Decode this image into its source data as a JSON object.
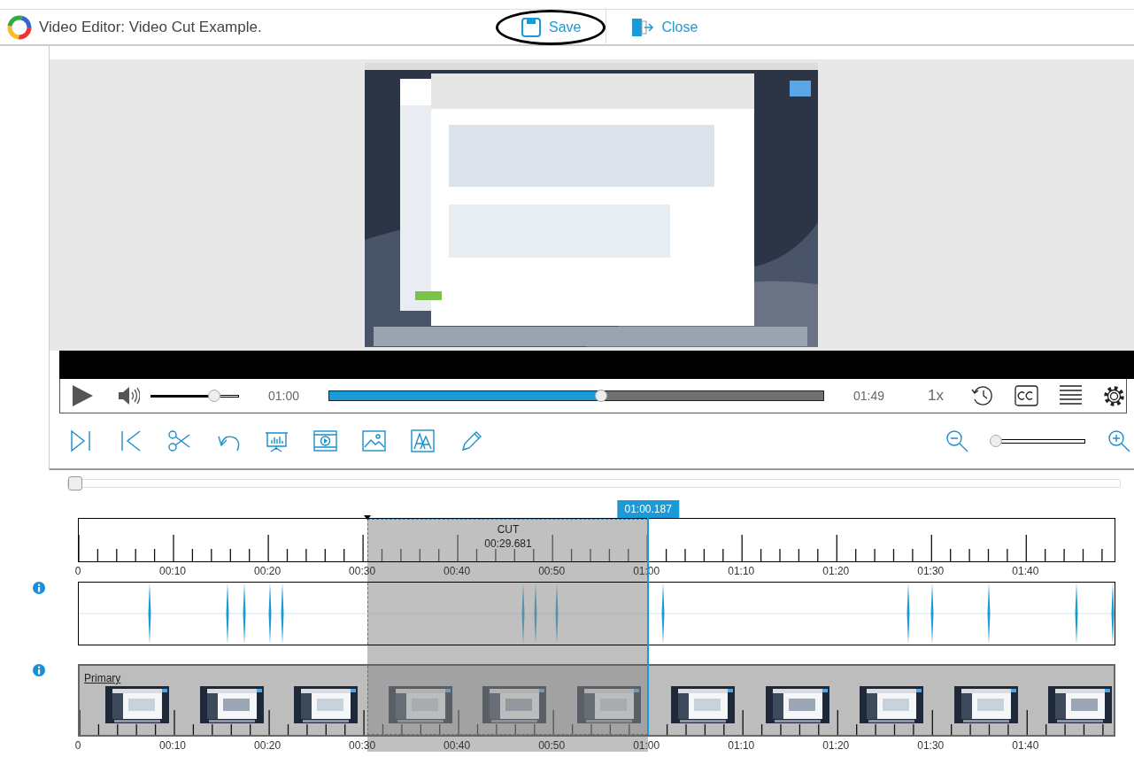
{
  "app": {
    "title": "Video Editor: Video Cut Example."
  },
  "header_buttons": [
    {
      "label": "Save",
      "kind": "save",
      "highlighted": true
    },
    {
      "label": "Close",
      "kind": "close",
      "highlighted": false
    }
  ],
  "player": {
    "current_time": "01:00",
    "duration": "01:49",
    "speed": "1x",
    "volume": {
      "level": 0.73
    },
    "progress": {
      "level": 0.55
    }
  },
  "timeline_zoom": {
    "level": 0.05
  },
  "cut": {
    "label": "CUT",
    "duration": "00:29.681",
    "playhead": "01:00.187"
  },
  "ruler_labels": [
    "0",
    "00:10",
    "00:20",
    "00:30",
    "00:40",
    "00:50",
    "01:00",
    "01:10",
    "01:20",
    "01:30",
    "01:40"
  ],
  "video_track": {
    "name": "Primary"
  },
  "track_labels": [
    "0",
    "00:10",
    "00:20",
    "00:30",
    "00:40",
    "00:50",
    "01:00",
    "01:10",
    "01:20",
    "01:30",
    "01:40"
  ]
}
